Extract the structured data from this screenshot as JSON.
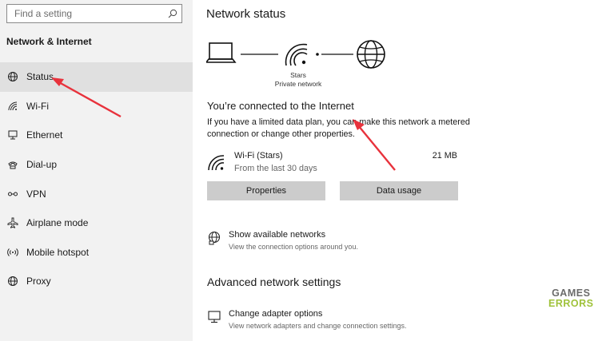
{
  "sidebar": {
    "search_placeholder": "Find a setting",
    "section_title": "Network & Internet",
    "items": [
      {
        "label": "Status",
        "icon": "globe-status-icon",
        "active": true
      },
      {
        "label": "Wi-Fi",
        "icon": "wifi-icon",
        "active": false
      },
      {
        "label": "Ethernet",
        "icon": "ethernet-icon",
        "active": false
      },
      {
        "label": "Dial-up",
        "icon": "dialup-icon",
        "active": false
      },
      {
        "label": "VPN",
        "icon": "vpn-icon",
        "active": false
      },
      {
        "label": "Airplane mode",
        "icon": "airplane-icon",
        "active": false
      },
      {
        "label": "Mobile hotspot",
        "icon": "hotspot-icon",
        "active": false
      },
      {
        "label": "Proxy",
        "icon": "globe-icon",
        "active": false
      }
    ]
  },
  "main": {
    "title": "Network status",
    "diagram": {
      "network_name": "Stars",
      "network_type": "Private network"
    },
    "connected_heading": "You’re connected to the Internet",
    "connected_desc": "If you have a limited data plan, you can make this network a metered connection or change other properties.",
    "usage": {
      "name": "Wi-Fi (Stars)",
      "period": "From the last 30 days",
      "amount": "21 MB"
    },
    "buttons": {
      "properties": "Properties",
      "data_usage": "Data usage"
    },
    "show_networks": {
      "title": "Show available networks",
      "subtitle": "View the connection options around you."
    },
    "advanced_heading": "Advanced network settings",
    "adapter": {
      "title": "Change adapter options",
      "subtitle": "View network adapters and change connection settings."
    }
  },
  "watermark": {
    "line1": "GAMES",
    "line2": "ERRORS"
  },
  "colors": {
    "sidebar_bg": "#f2f2f2",
    "active_item": "#e0e0e0",
    "button_bg": "#cccccc",
    "arrow": "#e8323c",
    "watermark_green": "#9fc23a"
  }
}
